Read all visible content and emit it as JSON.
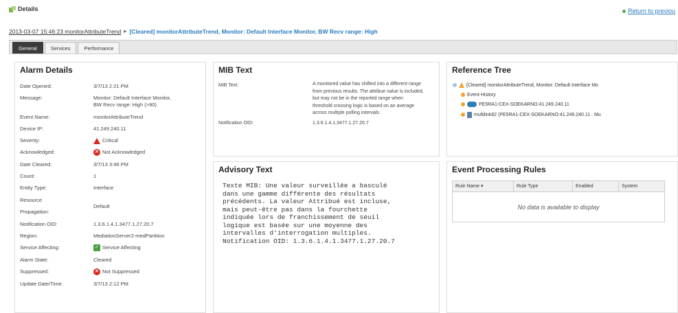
{
  "header": {
    "title": "Details",
    "return_link": "Return to previou"
  },
  "breadcrumb": {
    "link": "2013-03-07 15:46:23 monitorAttributeTrend",
    "current": "[Cleared] monitorAttributeTrend, Monitor: Default Interface Monitor, BW Recv range: High"
  },
  "tabs": [
    {
      "label": "General",
      "active": true
    },
    {
      "label": "Services",
      "active": false
    },
    {
      "label": "Performance",
      "active": false
    }
  ],
  "alarm_details": {
    "title": "Alarm Details",
    "rows": [
      {
        "key": "Date Opened:",
        "value": "3/7/13 2:21 PM"
      },
      {
        "key": "Message:",
        "value": "Monitor: Default Interface Monitor,",
        "value2": "BW Recv range: High (>90)"
      },
      {
        "key": "Event Name:",
        "value": "monitorAttributeTrend"
      },
      {
        "key": "Device IP:",
        "value": "41.249.240.11"
      },
      {
        "key": "Severity:",
        "value": "Critical",
        "icon": "critical-severity-icon"
      },
      {
        "key": "Acknowledged:",
        "value": "Not Acknowledged",
        "icon": "not-acknowledged-icon"
      },
      {
        "key": "Date Cleared:",
        "value": "3/7/13 3:46 PM"
      },
      {
        "key": "Count:",
        "value": "1"
      },
      {
        "key": "Entity Type:",
        "value": "Interface"
      },
      {
        "key": "Resource",
        "key2": "Propagation:",
        "value": "Default"
      },
      {
        "key": "Notification OID:",
        "value": "1.3.6.1.4.1.3477.1.27.20.7"
      },
      {
        "key": "Region:",
        "value": "MediationServer2-medPartition"
      },
      {
        "key": "Service Affecting:",
        "value": "Service Affecting",
        "icon": "service-affecting-icon"
      },
      {
        "key": "Alarm State:",
        "value": "Cleared"
      },
      {
        "key": "Suppressed:",
        "value": "Not Suppressed",
        "icon": "not-suppressed-icon"
      },
      {
        "key": "Update Date/Time:",
        "value": "3/7/13 2:12 PM"
      }
    ]
  },
  "mib_text": {
    "title": "MIB Text",
    "label": "MIB Text:",
    "text": "A monitored value has shifted into a different range from previous results. The attribue value is included, but may not be in the reported range when threshold crossing logic is based on an average across multiple polling intervals.",
    "oid_label": "Notification OID:",
    "oid_value": "1.3.6.1.4.1.3477.1.27.20.7"
  },
  "advisory_text": {
    "title": "Advisory Text",
    "body": "Texte MIB: Une valeur surveillée a basculé\ndans une gamme différente des résultats\nprécédents. La valeur Attribué est incluse,\nmais peut-être pas dans la fourchette\nindiquée lors de franchissement de seuil\nlogique est basée sur une moyenne des\nintervalles d'interrogation multiples.\nNotification OID: 1.3.6.1.4.1.3477.1.27.20.7"
  },
  "reference_tree": {
    "title": "Reference Tree",
    "items": [
      {
        "label": "[Cleared] monitorAttributeTrend, Monitor: Default Interface Mo",
        "icon": "warning-icon"
      },
      {
        "label": "Event History",
        "icon": ""
      },
      {
        "label": "PE5RA1-CEX-SOEKARNO:41.249.240.11",
        "icon": "router-icon"
      },
      {
        "label": "multilink82 (PE5RA1-CEX-SOEKARNO:41.249.240.11 : Mu",
        "icon": "interface-icon"
      }
    ]
  },
  "event_rules": {
    "title": "Event Processing Rules",
    "columns": [
      "Rule Name ▾",
      "Rule Type",
      "Enabled",
      "System"
    ],
    "empty_message": "No data is available to display"
  }
}
